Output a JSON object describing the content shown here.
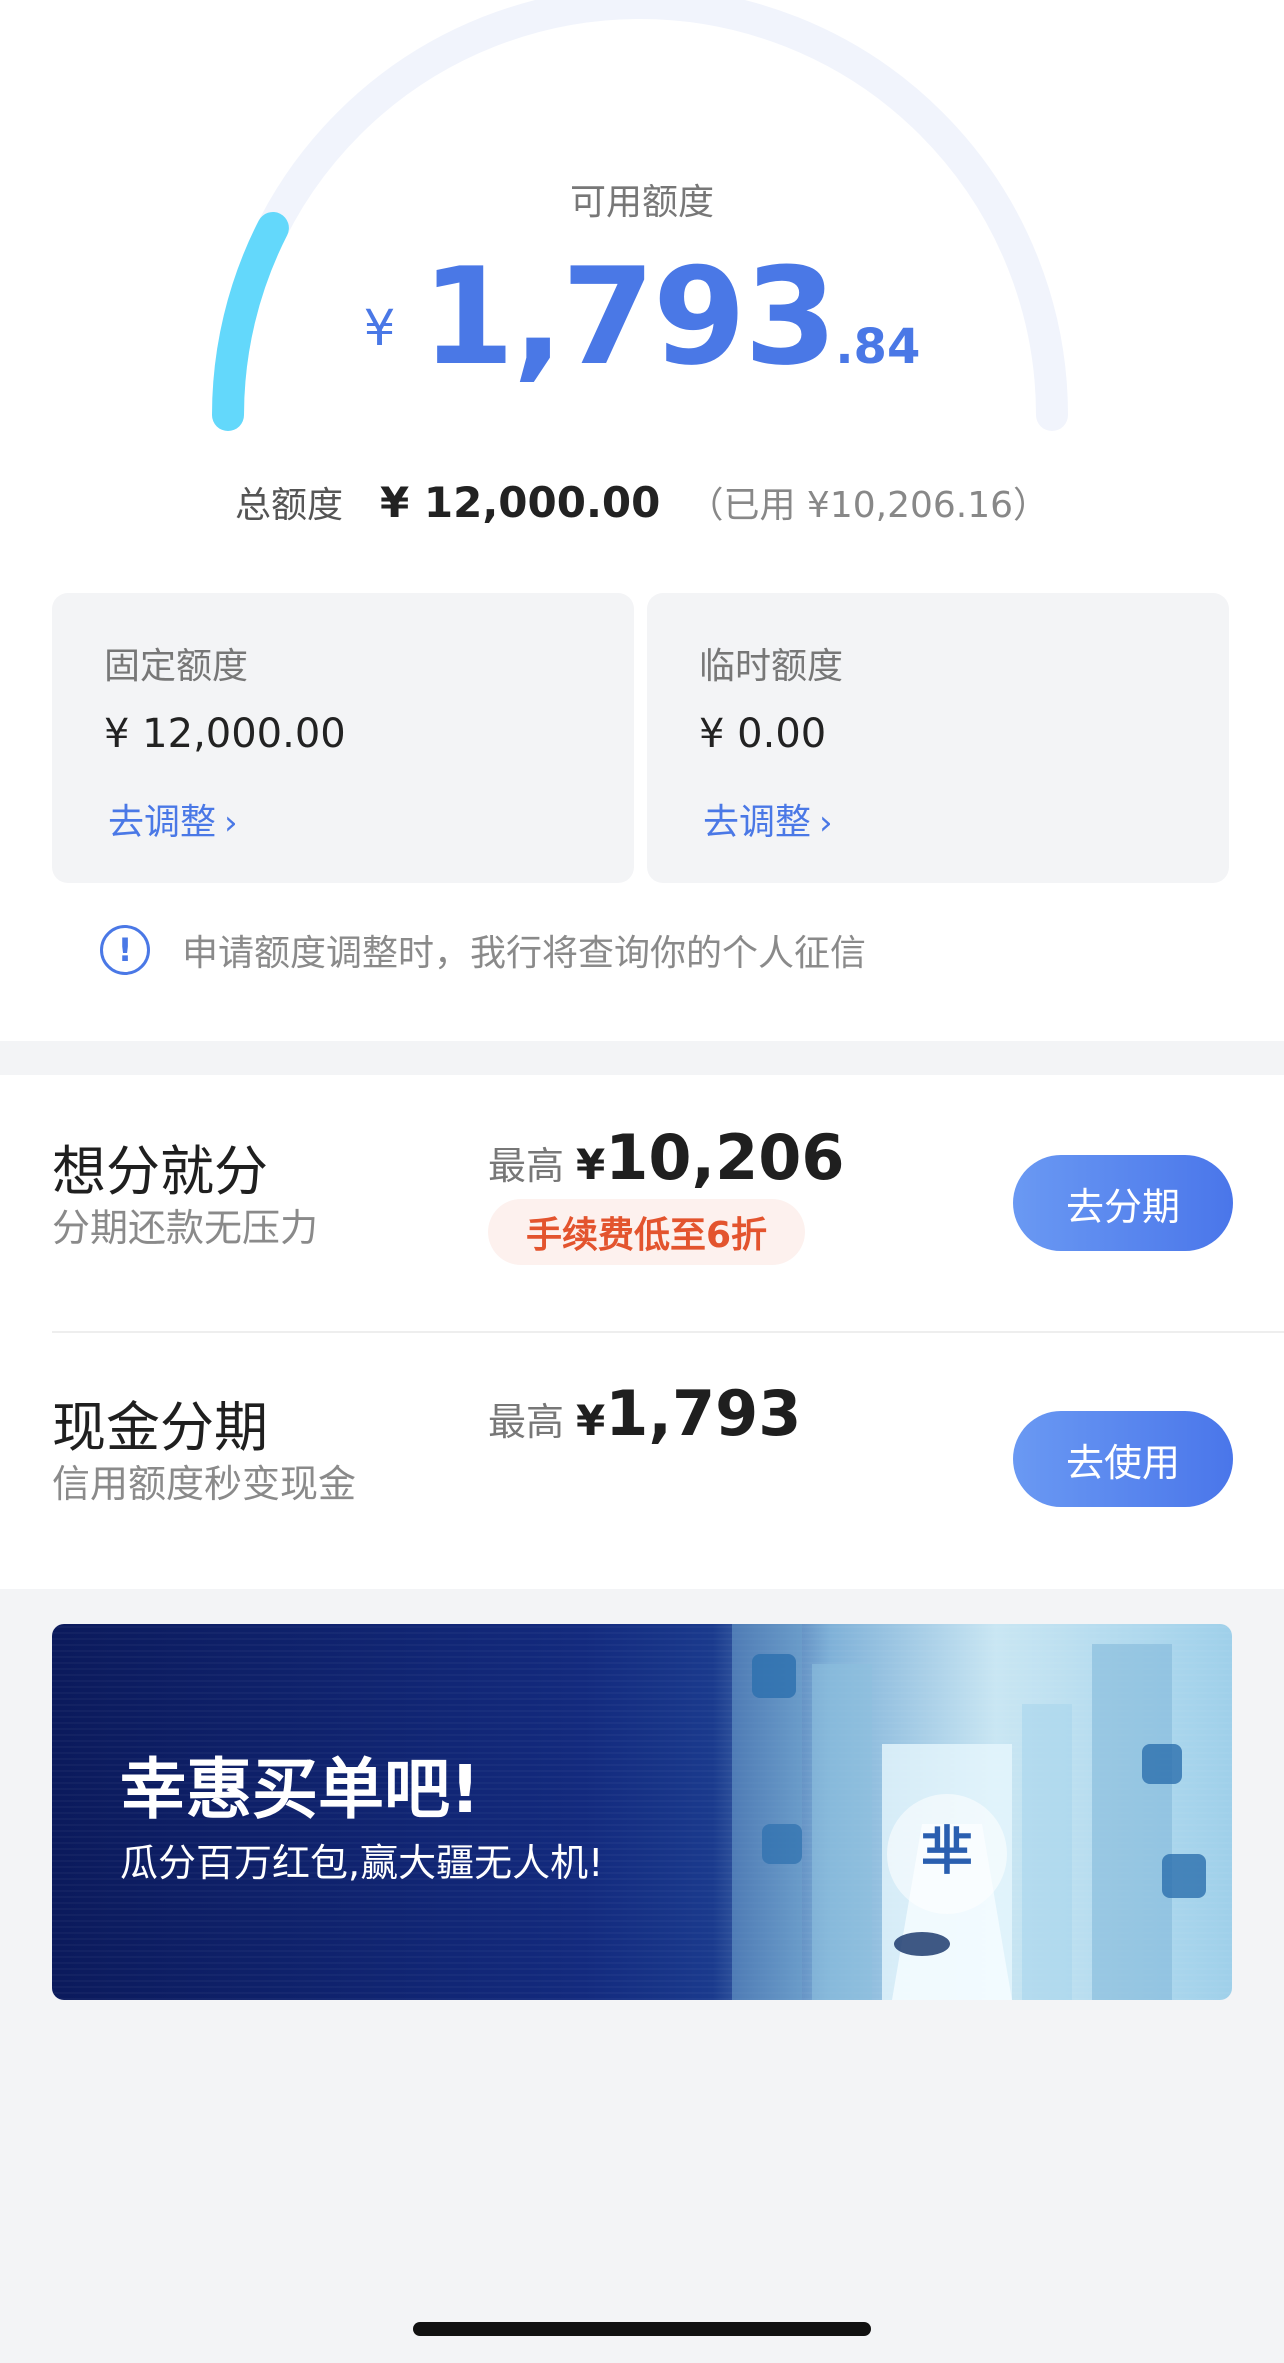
{
  "gauge": {
    "label": "可用额度",
    "currency": "¥",
    "integer": "1,793",
    "decimal": ".84",
    "used_ratio": 0.85,
    "track_color": "#f1f4fc",
    "fill_color": "#63d8fb"
  },
  "total": {
    "label": "总额度",
    "value": "¥ 12,000.00",
    "used": "（已用 ¥10,206.16）"
  },
  "fixed_limit": {
    "title": "固定额度",
    "value": "¥ 12,000.00",
    "link": "去调整"
  },
  "temp_limit": {
    "title": "临时额度",
    "value": "¥ 0.00",
    "link": "去调整"
  },
  "notice": {
    "icon": "info-icon",
    "text": "申请额度调整时，我行将查询你的个人征信"
  },
  "offers": [
    {
      "title": "想分就分",
      "subtitle": "分期还款无压力",
      "max_label": "最高",
      "currency": "¥",
      "max_value": "10,206",
      "badge": "手续费低至6折",
      "button": "去分期"
    },
    {
      "title": "现金分期",
      "subtitle": "信用额度秒变现金",
      "max_label": "最高",
      "currency": "¥",
      "max_value": "1,793",
      "button": "去使用"
    }
  ],
  "banner": {
    "title": "幸惠买单吧!",
    "subtitle": "瓜分百万红包,赢大疆无人机!"
  },
  "colors": {
    "accent": "#4a78e6",
    "badge_text": "#e3542e",
    "banner_dark": "#0b1a5c"
  }
}
